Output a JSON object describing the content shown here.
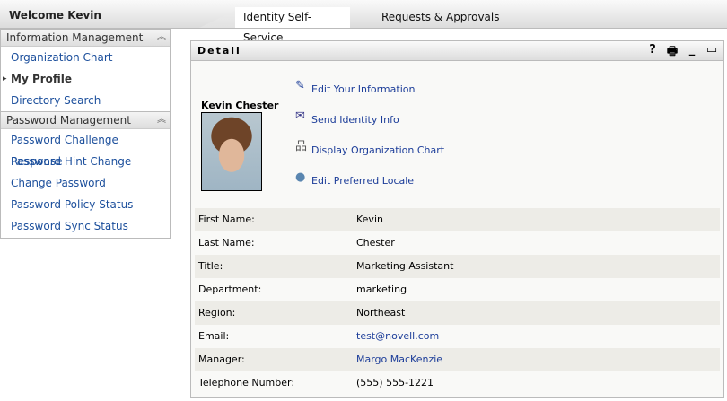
{
  "header": {
    "welcome": "Welcome Kevin",
    "tabs": [
      {
        "label": "Identity Self-Service",
        "active": true
      },
      {
        "label": "Requests & Approvals",
        "active": false
      }
    ]
  },
  "sidebar": {
    "sections": [
      {
        "title": "Information Management",
        "items": [
          {
            "label": "Organization Chart"
          },
          {
            "label": "My Profile",
            "current": true
          },
          {
            "label": "Directory Search"
          }
        ]
      },
      {
        "title": "Password Management",
        "items": [
          {
            "label": "Password Challenge Response"
          },
          {
            "label": "Password Hint Change"
          },
          {
            "label": "Change Password"
          },
          {
            "label": "Password Policy Status"
          },
          {
            "label": "Password Sync Status"
          }
        ]
      }
    ]
  },
  "panel": {
    "title": "Detail",
    "icons": [
      "help-icon",
      "print-icon",
      "minimize-icon",
      "maximize-icon"
    ],
    "user_name": "Kevin Chester",
    "actions": [
      {
        "label": "Edit Your Information",
        "icon": "pencil-icon"
      },
      {
        "label": "Send Identity Info",
        "icon": "envelope-icon"
      },
      {
        "label": "Display Organization Chart",
        "icon": "org-chart-icon"
      },
      {
        "label": "Edit Preferred Locale",
        "icon": "globe-icon"
      }
    ],
    "fields": [
      {
        "label": "First Name:",
        "value": "Kevin"
      },
      {
        "label": "Last Name:",
        "value": "Chester"
      },
      {
        "label": "Title:",
        "value": "Marketing Assistant"
      },
      {
        "label": "Department:",
        "value": "marketing"
      },
      {
        "label": "Region:",
        "value": "Northeast"
      },
      {
        "label": "Email:",
        "value": "test@novell.com",
        "link": true
      },
      {
        "label": "Manager:",
        "value": "Margo MacKenzie",
        "link": true
      },
      {
        "label": "Telephone Number:",
        "value": "(555) 555-1221"
      }
    ]
  }
}
